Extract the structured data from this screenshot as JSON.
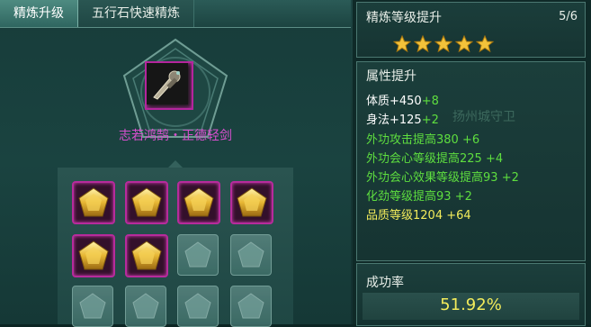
{
  "tabs": [
    {
      "label": "精炼升级",
      "active": true
    },
    {
      "label": "五行石快速精炼",
      "active": false
    }
  ],
  "item": {
    "name": "志若鸿鹄・正德轻剑",
    "name_color": "#d84fcf",
    "frame_color": "#b5259d"
  },
  "stone_slots": {
    "rows": [
      [
        "gold",
        "gold",
        "gold",
        "gold"
      ],
      [
        "gold",
        "gold",
        "empty",
        "empty"
      ],
      [
        "empty",
        "empty",
        "empty",
        "empty"
      ]
    ],
    "gold_icon": "gold-pentagon-stone-icon",
    "empty_icon": "empty-stone-slot-icon"
  },
  "refine_level": {
    "title": "精炼等级提升",
    "count": "5/6",
    "stars": 5,
    "star_color": "#f3c23a"
  },
  "attributes": {
    "title": "属性提升",
    "lines": [
      {
        "text": "体质+450",
        "bonus": "+8",
        "text_color": "white"
      },
      {
        "text": "身法+125",
        "bonus": "+2",
        "text_color": "white"
      },
      {
        "text": "外功攻击提高380",
        "bonus": "+6",
        "text_color": "green"
      },
      {
        "text": "外功会心等级提高225",
        "bonus": "+4",
        "text_color": "green"
      },
      {
        "text": "外功会心效果等级提高93",
        "bonus": "+2",
        "text_color": "green"
      },
      {
        "text": "化劲等级提高93",
        "bonus": "+2",
        "text_color": "green"
      },
      {
        "text": "品质等级1204",
        "bonus": "+64",
        "text_color": "yellow"
      }
    ],
    "watermark": "扬州城守卫"
  },
  "success_rate": {
    "label": "成功率",
    "value": "51.92%"
  },
  "colors": {
    "green": "#5ede3f",
    "yellow": "#f3ec5b",
    "white": "#ffffff"
  }
}
